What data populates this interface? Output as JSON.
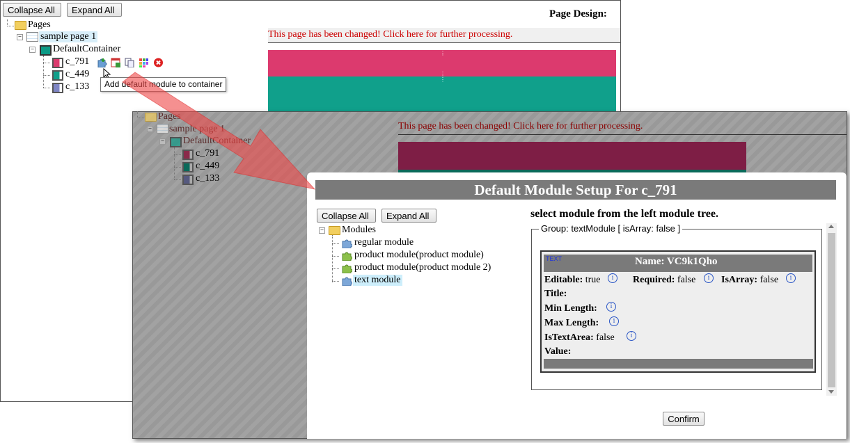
{
  "back": {
    "collapse_label": "Collapse All",
    "expand_label": "Expand All",
    "page_design_title": "Page Design:",
    "changed_msg": "This page has been changed! Click here for further processing.",
    "tree": {
      "pages": "Pages",
      "sample_page": "sample page 1",
      "container": "DefaultContainer",
      "items": [
        "c_791",
        "c_449",
        "c_133"
      ]
    },
    "tooltip": "Add default module to container"
  },
  "modal": {
    "title": "Default Module Setup For c_791",
    "collapse_label": "Collapse All",
    "expand_label": "Expand All",
    "modules_root": "Modules",
    "modules": [
      "regular module",
      "product module(product module)",
      "product module(product module 2)",
      "text module"
    ],
    "instruction": "select module from the left module tree.",
    "group_legend": "Group: textModule [ isArray: false ]",
    "field": {
      "tag": "TEXT",
      "name_label": "Name: VC9k1Qho",
      "editable_label": "Editable:",
      "editable_value": "true",
      "required_label": "Required:",
      "required_value": "false",
      "isarray_label": "IsArray:",
      "isarray_value": "false",
      "title_label": "Title:",
      "minlength_label": "Min Length:",
      "maxlength_label": "Max Length:",
      "istextarea_label": "IsTextArea:",
      "istextarea_value": "false",
      "value_label": "Value:"
    },
    "confirm_label": "Confirm"
  },
  "colors": {
    "pink": "#dc3a6e",
    "teal": "#10a08b",
    "dark_pink": "#7e1e45",
    "modal_header": "#7a7a7a",
    "error_red": "#cc0000"
  }
}
